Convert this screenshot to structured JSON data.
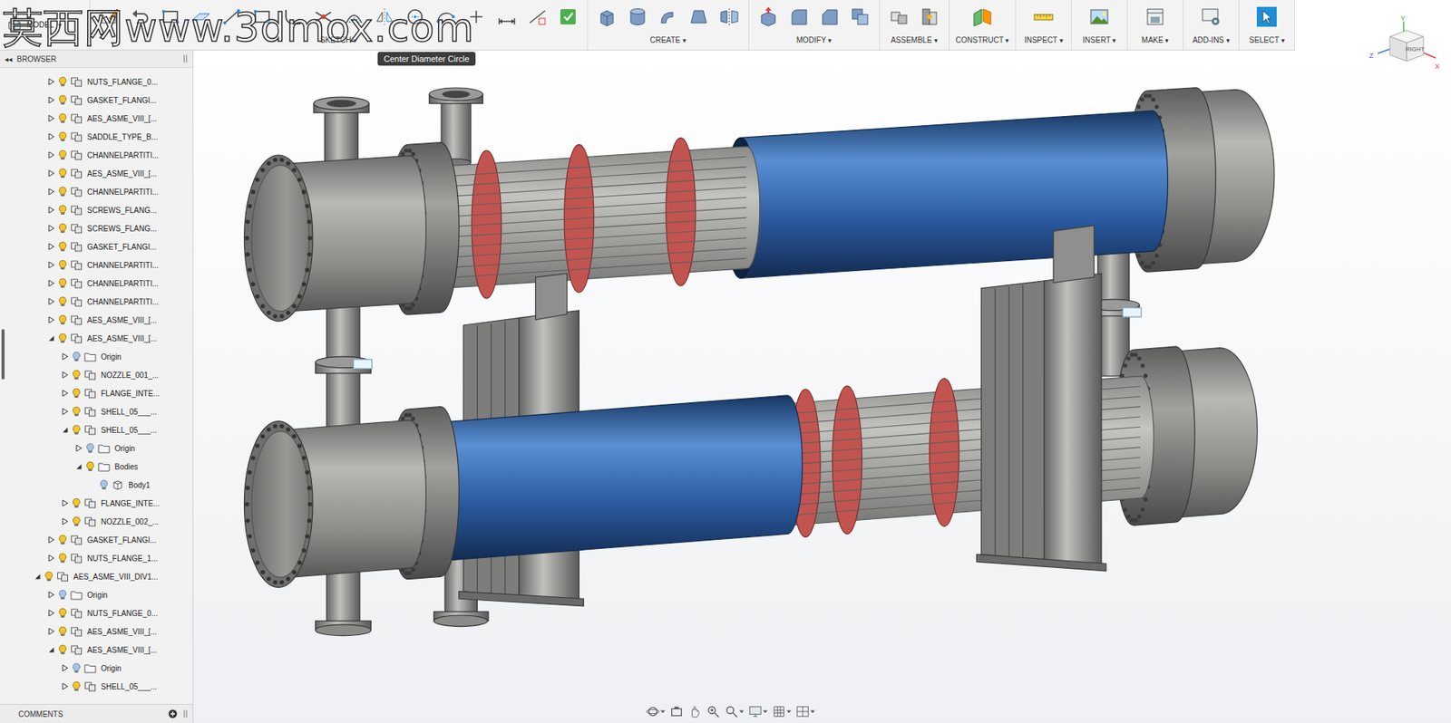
{
  "watermark": "莫西网www.3dmox.com",
  "toolbar": {
    "workspace": "MODEL",
    "arrow": "▾",
    "groups": [
      {
        "label": "SKETCH"
      },
      {
        "label": "CREATE"
      },
      {
        "label": "MODIFY"
      },
      {
        "label": "ASSEMBLE"
      },
      {
        "label": "CONSTRUCT"
      },
      {
        "label": "INSPECT"
      },
      {
        "label": "INSERT"
      },
      {
        "label": "MAKE"
      },
      {
        "label": "ADD-INS"
      },
      {
        "label": "SELECT"
      }
    ]
  },
  "tooltip": "Center Diameter Circle",
  "browser": {
    "collapse": "◂◂",
    "title": "BROWSER",
    "rows": [
      {
        "label": "NUTS_FLANGE_0...",
        "level": 1,
        "kind": "component",
        "expanded": false,
        "visible": true
      },
      {
        "label": "GASKET_FLANGI...",
        "level": 1,
        "kind": "component",
        "expanded": false,
        "visible": true
      },
      {
        "label": "AES_ASME_VIII_[...",
        "level": 1,
        "kind": "component",
        "expanded": false,
        "visible": true
      },
      {
        "label": "SADDLE_TYPE_B...",
        "level": 1,
        "kind": "component",
        "expanded": false,
        "visible": true
      },
      {
        "label": "CHANNELPARTITI...",
        "level": 1,
        "kind": "component",
        "expanded": false,
        "visible": true
      },
      {
        "label": "AES_ASME_VIII_[...",
        "level": 1,
        "kind": "component",
        "expanded": false,
        "visible": true
      },
      {
        "label": "CHANNELPARTITI...",
        "level": 1,
        "kind": "component",
        "expanded": false,
        "visible": true
      },
      {
        "label": "SCREWS_FLANG...",
        "level": 1,
        "kind": "component",
        "expanded": false,
        "visible": true
      },
      {
        "label": "SCREWS_FLANG...",
        "level": 1,
        "kind": "component",
        "expanded": false,
        "visible": true
      },
      {
        "label": "GASKET_FLANGI...",
        "level": 1,
        "kind": "component",
        "expanded": false,
        "visible": true
      },
      {
        "label": "CHANNELPARTITI...",
        "level": 1,
        "kind": "component",
        "expanded": false,
        "visible": true
      },
      {
        "label": "CHANNELPARTITI...",
        "level": 1,
        "kind": "component",
        "expanded": false,
        "visible": true
      },
      {
        "label": "CHANNELPARTITI...",
        "level": 1,
        "kind": "component",
        "expanded": false,
        "visible": true
      },
      {
        "label": "AES_ASME_VIII_[...",
        "level": 1,
        "kind": "component",
        "expanded": false,
        "visible": true
      },
      {
        "label": "AES_ASME_VIII_[...",
        "level": 1,
        "kind": "component",
        "expanded": true,
        "visible": true
      },
      {
        "label": "Origin",
        "level": 2,
        "kind": "folder",
        "expanded": false,
        "visible": false
      },
      {
        "label": "NOZZLE_001_...",
        "level": 2,
        "kind": "component",
        "expanded": false,
        "visible": true
      },
      {
        "label": "FLANGE_INTE...",
        "level": 2,
        "kind": "component",
        "expanded": false,
        "visible": true
      },
      {
        "label": "SHELL_05___...",
        "level": 2,
        "kind": "component",
        "expanded": false,
        "visible": true
      },
      {
        "label": "SHELL_05___...",
        "level": 2,
        "kind": "component",
        "expanded": true,
        "visible": true
      },
      {
        "label": "Origin",
        "level": 3,
        "kind": "folder",
        "expanded": false,
        "visible": false
      },
      {
        "label": "Bodies",
        "level": 3,
        "kind": "folder",
        "expanded": true,
        "visible": true
      },
      {
        "label": "Body1",
        "level": 4,
        "kind": "body",
        "expanded": false,
        "visible": false
      },
      {
        "label": "FLANGE_INTE...",
        "level": 2,
        "kind": "component",
        "expanded": false,
        "visible": true
      },
      {
        "label": "NOZZLE_002_...",
        "level": 2,
        "kind": "component",
        "expanded": false,
        "visible": true
      },
      {
        "label": "GASKET_FLANGI...",
        "level": 1,
        "kind": "component",
        "expanded": false,
        "visible": true
      },
      {
        "label": "NUTS_FLANGE_1...",
        "level": 1,
        "kind": "component",
        "expanded": false,
        "visible": true
      },
      {
        "label": "AES_ASME_VIII_DIV1...",
        "level": 0,
        "kind": "component",
        "expanded": true,
        "visible": true
      },
      {
        "label": "Origin",
        "level": 1,
        "kind": "folder",
        "expanded": false,
        "visible": false
      },
      {
        "label": "NUTS_FLANGE_0...",
        "level": 1,
        "kind": "component",
        "expanded": false,
        "visible": true
      },
      {
        "label": "AES_ASME_VIII_[...",
        "level": 1,
        "kind": "component",
        "expanded": false,
        "visible": true
      },
      {
        "label": "AES_ASME_VIII_[...",
        "level": 1,
        "kind": "component",
        "expanded": true,
        "visible": true
      },
      {
        "label": "Origin",
        "level": 2,
        "kind": "folder",
        "expanded": false,
        "visible": false
      },
      {
        "label": "SHELL_05___...",
        "level": 2,
        "kind": "component",
        "expanded": false,
        "visible": true
      }
    ]
  },
  "comments": {
    "label": "COMMENTS"
  },
  "viewcube": {
    "face": "RIGHT",
    "axes": [
      {
        "label": "Y",
        "color": "#3cb44b"
      },
      {
        "label": "Z",
        "color": "#3a6fd8"
      },
      {
        "label": "X",
        "color": "#e03c31"
      }
    ]
  }
}
